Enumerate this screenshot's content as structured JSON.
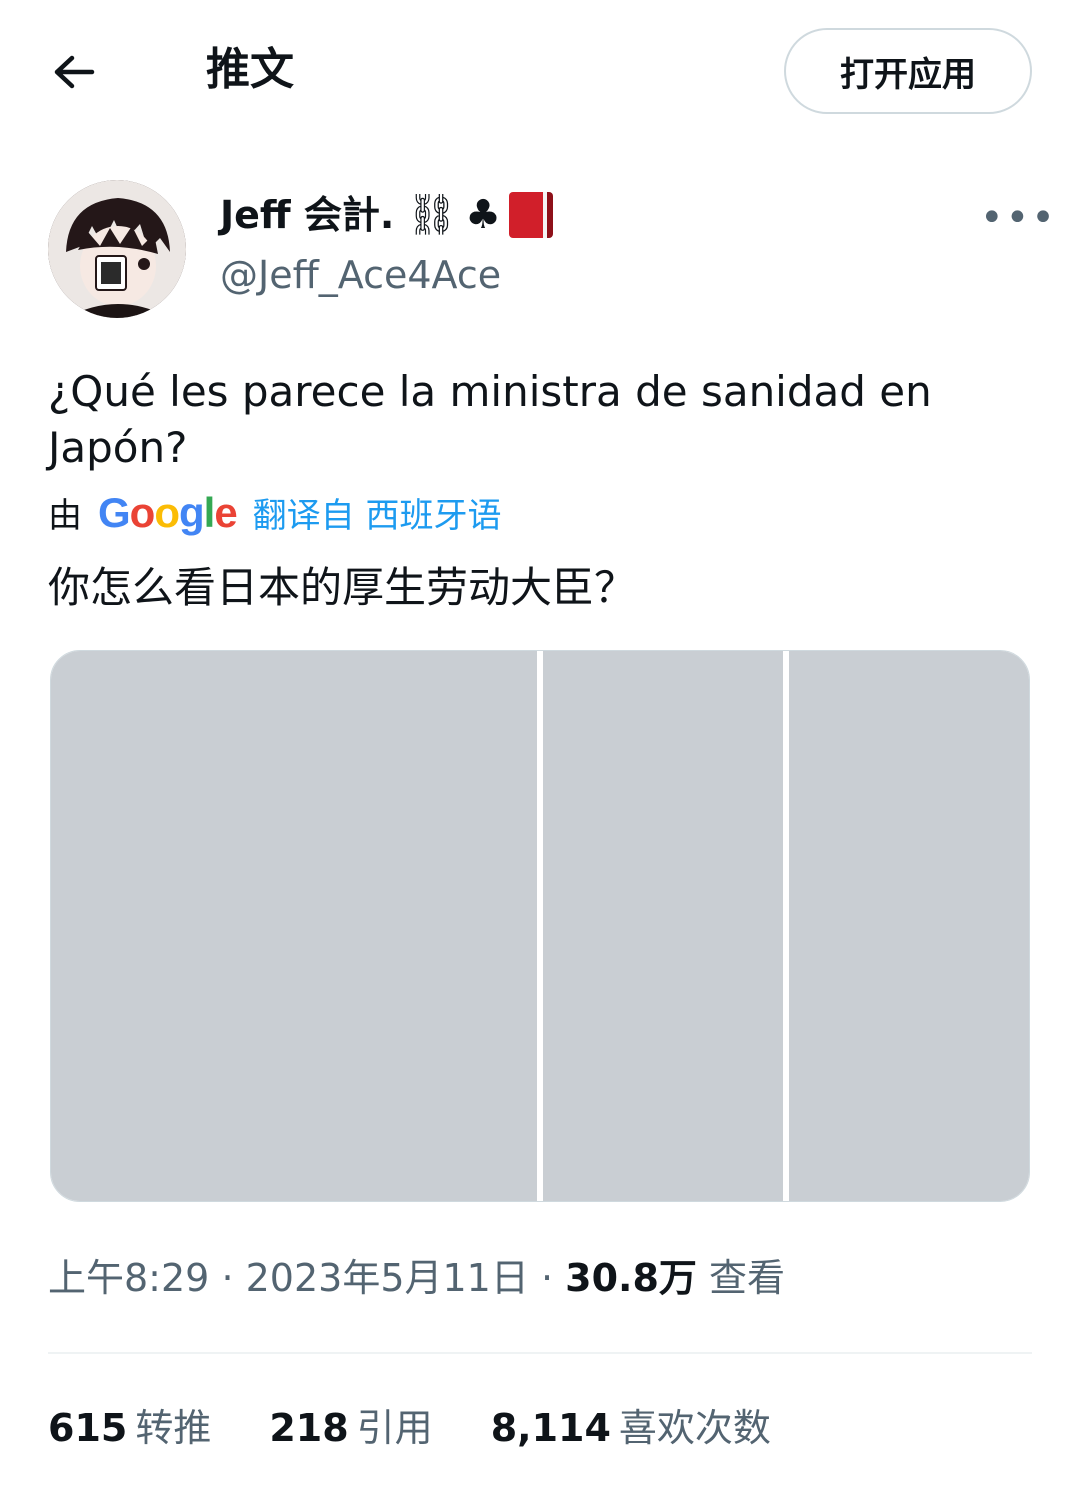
{
  "header": {
    "back_icon": "arrow-left-icon",
    "title": "推文",
    "open_app_label": "打开应用"
  },
  "author": {
    "name": "Jeff 会計.",
    "badges": [
      "⛓",
      "♣"
    ],
    "badge_icon_names": [
      "chain-link-icon",
      "club-suit-icon",
      "red-book-icon"
    ],
    "handle": "@Jeff_Ace4Ace"
  },
  "more_icon": "more-horizontal-icon",
  "tweet": {
    "original_text": "¿Qué les parece la ministra de sanidad en Japón?",
    "translation_via": "由",
    "translation_link": "翻译自 西班牙语",
    "translated_text": "你怎么看日本的厚生劳动大臣？"
  },
  "media": {
    "count": 3,
    "placeholder_label": ""
  },
  "meta": {
    "time": "上午8:29",
    "date": "2023年5月11日",
    "views_count": "30.8万",
    "views_label": "查看"
  },
  "stats": {
    "retweets_count": "615",
    "retweets_label": "转推",
    "quotes_count": "218",
    "quotes_label": "引用",
    "likes_count": "8,114",
    "likes_label": "喜欢次数"
  },
  "colors": {
    "text_primary": "#0f1419",
    "text_secondary": "#536471",
    "link": "#1d9bf0",
    "border": "#cfd9de"
  }
}
